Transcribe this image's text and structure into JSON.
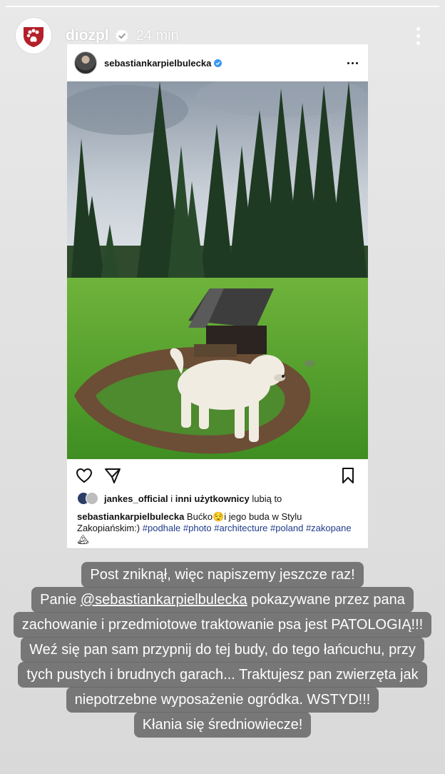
{
  "story": {
    "progress": 1.0,
    "username": "diozpl",
    "verified": true,
    "time": "24 min",
    "icons": {
      "avatar": "paw-shield-logo",
      "verified": "verified-badge-icon",
      "menu": "more-vertical-icon"
    }
  },
  "post": {
    "username": "sebastiankarpielbulecka",
    "verified": true,
    "icons": [
      "heart-icon",
      "send-icon",
      "bookmark-icon",
      "more-horizontal-icon"
    ],
    "likes": {
      "prefix": "jankes_official",
      "middle": " i ",
      "suffix_bold": "inni użytkownicy",
      "suffix": " lubią to"
    },
    "caption": {
      "username": "sebastiankarpielbulecka",
      "text_1": " Bućko",
      "text_2": "i jego buda w Stylu Zakopiańskim:) ",
      "tags": [
        "#podhale",
        "#photo",
        "#architecture",
        "#poland",
        "#zakopane"
      ]
    }
  },
  "overlay_text": {
    "line1": "Post zniknął, więc napiszemy jeszcze raz!",
    "line2_pre": "Panie ",
    "line2_mention": "@sebastiankarpielbulecka",
    "line2_post": " pokazywane przez pana",
    "line3": "zachowanie i przedmiotowe traktowanie psa jest PATOLOGIĄ!!!",
    "line4": "Weź się pan sam przypnij do tej budy, do tego łańcuchu, przy",
    "line5": "tych pustych i brudnych garach... Traktujesz pan zwierzęta jak",
    "line6": "niepotrzebne wyposażenie ogródka. WSTYD!!!",
    "line7": "Kłania się średniowiecze!"
  }
}
